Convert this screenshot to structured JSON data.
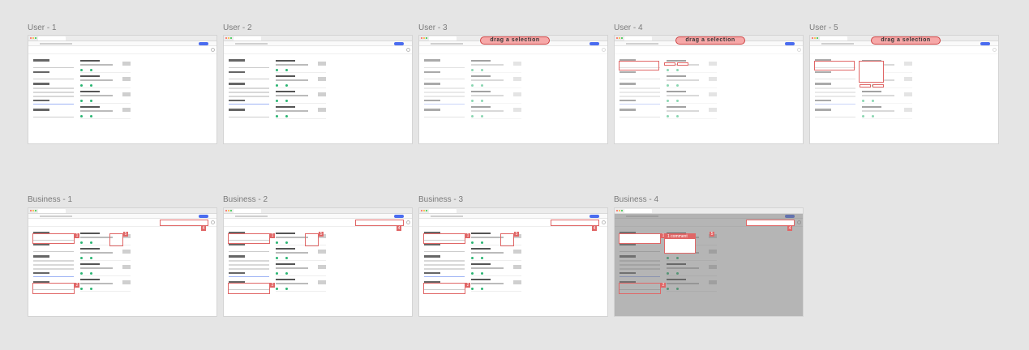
{
  "frames": [
    {
      "label": "User - 1"
    },
    {
      "label": "User - 2"
    },
    {
      "label": "User - 3",
      "banner": "drag a selection"
    },
    {
      "label": "User - 4",
      "banner": "drag a selection"
    },
    {
      "label": "User - 5",
      "banner": "drag a selection"
    },
    {
      "label": "Business - 1"
    },
    {
      "label": "Business - 2"
    },
    {
      "label": "Business - 3"
    },
    {
      "label": "Business - 4",
      "comment": "1 comment"
    }
  ],
  "colors": {
    "background": "#e5e5e5",
    "highlight": "#e06666",
    "banner_fill": "#f6a8a8",
    "accent": "#4a6cf0",
    "status_green": "#2bb673"
  },
  "icons": {
    "window_controls": "traffic-light-icons",
    "profile": "profile-pill-icon",
    "settings": "gear-icon"
  },
  "callout_numbers": [
    "1",
    "2",
    "3",
    "4",
    "5"
  ]
}
